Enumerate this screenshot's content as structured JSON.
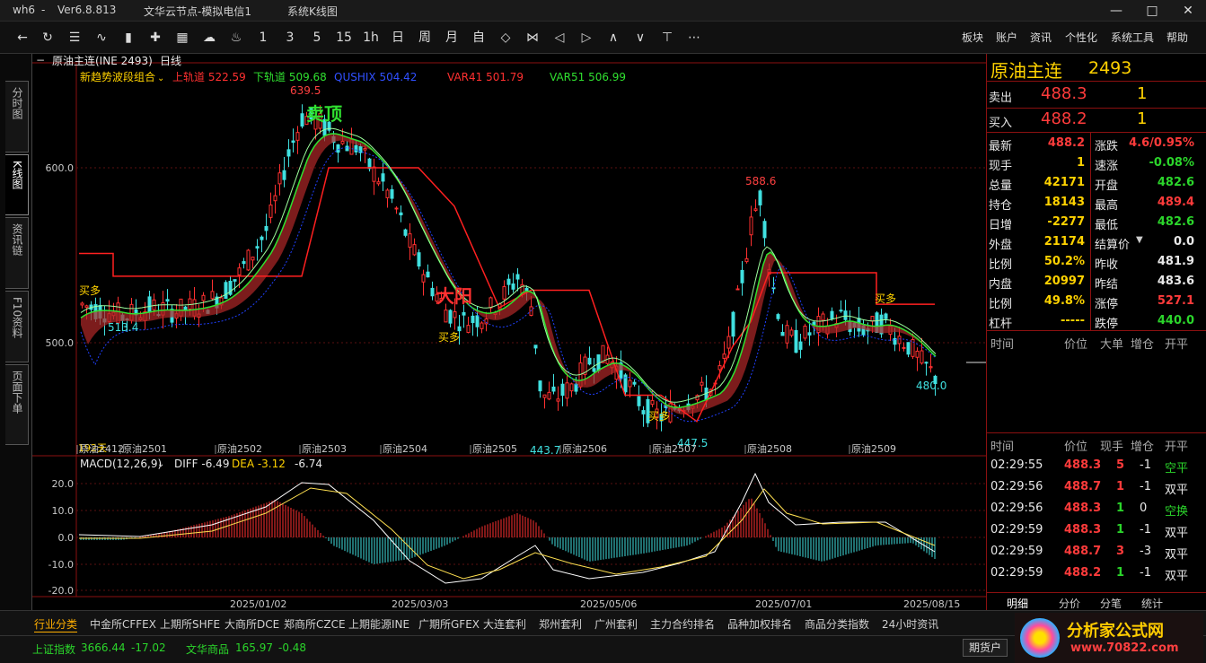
{
  "titlebar": {
    "app_id": "wh6",
    "sep": "-",
    "version": "Ver6.8.813",
    "server": "文华云节点-模拟电信1",
    "mode": "系统K线图"
  },
  "toolbar": {
    "icons": [
      "back-icon",
      "refresh-icon",
      "list-icon",
      "line-chart-icon",
      "kline-icon",
      "crosshair-icon",
      "grid-icon",
      "cloud-icon",
      "bell-icon"
    ],
    "periods": [
      "1",
      "3",
      "5",
      "15",
      "1h",
      "日",
      "周",
      "月",
      "自"
    ],
    "menus": [
      "板块",
      "账户",
      "资讯",
      "个性化",
      "系统工具",
      "帮助"
    ]
  },
  "left_tabs": [
    "分时图",
    "K线图",
    "资讯链",
    "F10资料",
    "页面下单"
  ],
  "chart": {
    "symbol_label": "原油主连(INE 2493)",
    "period_label": "日线",
    "indicator_name": "新趋势波段组合",
    "indicators": [
      {
        "name": "上轨道",
        "value": "522.59",
        "color": "#ff3030"
      },
      {
        "name": "下轨道",
        "value": "509.68",
        "color": "#30e030"
      },
      {
        "name": "QUSHIX",
        "value": "504.42",
        "color": "#3050ff"
      },
      {
        "name": "VAR41",
        "value": "501.79",
        "color": "#ff3030"
      },
      {
        "name": "VAR51",
        "value": "506.99",
        "color": "#30e030"
      }
    ],
    "price_axis": [
      "600.0",
      "500.0"
    ],
    "annotations": {
      "high1": "639.5",
      "high2": "588.6",
      "low1": "513.4",
      "low2": "443.7",
      "low3": "447.5",
      "last": "480.0",
      "top_label": "卖顶",
      "mid_label": "大阳",
      "buy_labels": [
        "买多",
        "买多",
        "买多",
        "买多"
      ],
      "day_count": "192天"
    },
    "contracts": [
      "原油2412",
      "原油2501",
      "原油2502",
      "原油2503",
      "原油2504",
      "原油2505",
      "原油2506",
      "原油2507",
      "原油2508",
      "原油2509"
    ],
    "macd": {
      "label": "MACD(12,26,9)",
      "diff": "DIFF -6.49",
      "dea": "DEA -3.12",
      "macd": "-6.74",
      "axis": [
        "20.0",
        "10.0",
        "0.0",
        "-10.0",
        "-20.0"
      ]
    },
    "dates": [
      "2025/01/02",
      "2025/03/03",
      "2025/05/06",
      "2025/07/01",
      "2025/08/15"
    ]
  },
  "quote": {
    "name": "原油主连",
    "code": "2493",
    "sell": {
      "label": "卖出",
      "price": "488.3",
      "qty": "1"
    },
    "buy": {
      "label": "买入",
      "price": "488.2",
      "qty": "1"
    },
    "rows": [
      {
        "l1": "最新",
        "v1": "488.2",
        "c1": "red",
        "l2": "涨跌",
        "v2": "4.6/0.95%",
        "c2": "red"
      },
      {
        "l1": "现手",
        "v1": "1",
        "c1": "yellow",
        "l2": "速涨",
        "v2": "-0.08%",
        "c2": "green"
      },
      {
        "l1": "总量",
        "v1": "42171",
        "c1": "yellow",
        "l2": "开盘",
        "v2": "482.6",
        "c2": "green"
      },
      {
        "l1": "持仓",
        "v1": "18143",
        "c1": "yellow",
        "l2": "最高",
        "v2": "489.4",
        "c2": "red"
      },
      {
        "l1": "日增",
        "v1": "-2277",
        "c1": "yellow",
        "l2": "最低",
        "v2": "482.6",
        "c2": "green"
      },
      {
        "l1": "外盘",
        "v1": "21174",
        "c1": "yellow",
        "l2": "结算价",
        "v2": "0.0",
        "c2": "white"
      },
      {
        "l1": "比例",
        "v1": "50.2%",
        "c1": "yellow",
        "l2": "昨收",
        "v2": "481.9",
        "c2": "white"
      },
      {
        "l1": "内盘",
        "v1": "20997",
        "c1": "yellow",
        "l2": "昨结",
        "v2": "483.6",
        "c2": "white"
      },
      {
        "l1": "比例",
        "v1": "49.8%",
        "c1": "yellow",
        "l2": "涨停",
        "v2": "527.1",
        "c2": "red"
      },
      {
        "l1": "杠杆",
        "v1": "-----",
        "c1": "yellow",
        "l2": "跌停",
        "v2": "440.0",
        "c2": "green"
      }
    ],
    "tick_header1": [
      "时间",
      "价位",
      "大单",
      "增仓",
      "开平"
    ],
    "tick_header2": [
      "时间",
      "价位",
      "现手",
      "增仓",
      "开平"
    ],
    "ticks": [
      {
        "time": "02:29:55",
        "price": "488.3",
        "qty": "5",
        "inc": "-1",
        "type": "空平",
        "qc": "red",
        "tc": "green"
      },
      {
        "time": "02:29:56",
        "price": "488.7",
        "qty": "1",
        "inc": "-1",
        "type": "双平",
        "qc": "red",
        "tc": "white"
      },
      {
        "time": "02:29:56",
        "price": "488.3",
        "qty": "1",
        "inc": "0",
        "type": "空换",
        "qc": "green",
        "tc": "green"
      },
      {
        "time": "02:29:59",
        "price": "488.3",
        "qty": "1",
        "inc": "-1",
        "type": "双平",
        "qc": "green",
        "tc": "white"
      },
      {
        "time": "02:29:59",
        "price": "488.7",
        "qty": "3",
        "inc": "-3",
        "type": "双平",
        "qc": "red",
        "tc": "white"
      },
      {
        "time": "02:29:59",
        "price": "488.2",
        "qty": "1",
        "inc": "-1",
        "type": "双平",
        "qc": "green",
        "tc": "white"
      }
    ],
    "subtabs": [
      "明细",
      "分价",
      "分笔",
      "统计"
    ]
  },
  "bottom": {
    "tabs": [
      "行业分类",
      "中金所CFFEX",
      "上期所SHFE",
      "大商所DCE",
      "郑商所CZCE",
      "上期能源INE",
      "广期所GFEX",
      "大连套利",
      "郑州套利",
      "广州套利",
      "主力合约排名",
      "品种加权排名",
      "商品分类指数",
      "24小时资讯"
    ],
    "status": [
      {
        "name": "上证指数",
        "value": "3666.44",
        "change": "-17.02"
      },
      {
        "name": "文华商品",
        "value": "165.97",
        "change": "-0.48"
      }
    ],
    "account_button": "期货户",
    "watermark": "分析家公式网",
    "watermark_url": "www.70822.com"
  }
}
